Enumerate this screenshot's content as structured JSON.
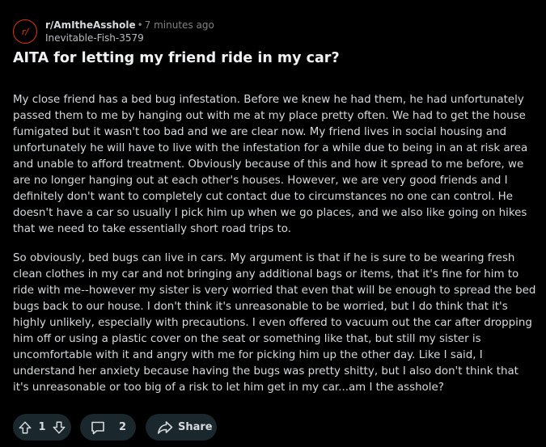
{
  "post": {
    "avatar_text": "r/",
    "subreddit": "r/AmItheAsshole",
    "time": "7 minutes ago",
    "author": "Inevitable-Fish-3579",
    "title": "AITA for letting my friend ride in my car?",
    "body": [
      "My close friend has a bed bug infestation. Before we knew he had them, he had unfortunately passed them to me by hanging out with me at my place pretty often. We had to get the house fumigated but it wasn't too bad and we are clear now. My friend lives in social housing and unfortunately he will have to live with the infestation for a while due to being in an at risk area and unable to afford treatment. Obviously because of this and how it spread to me before, we are no longer hanging out at each other's houses. However, we are very good friends and I definitely don't want to completely cut contact due to circumstances no one can control. He doesn't have a car so usually I pick him up when we go places, and we also like going on hikes that we need to take essentially short road trips to.",
      "So obviously, bed bugs can live in cars. My argument is that if he is sure to be wearing fresh clean clothes in my car and not bringing any additional bags or items, that it's fine for him to ride with me--however my sister is very worried that even that will be enough to spread the bed bugs back to our house. I don't think it's unreasonable to be worried, but I do think that it's highly unlikely, especially with precautions. I even offered to vacuum out the car after dropping him off or using a plastic cover on the seat or something like that, but still my sister is uncomfortable with it and angry with me for picking him up the other day. Like I said, I understand her anxiety because having the bugs was pretty shitty, but I also don't think that it's unreasonable or too big of a risk to let him get in my car...am I the asshole?"
    ]
  },
  "actions": {
    "vote_count": "1",
    "comment_count": "2",
    "share_label": "Share"
  },
  "icons": {
    "upvote": "upvote-icon",
    "downvote": "downvote-icon",
    "comment": "comment-icon",
    "share": "share-icon"
  },
  "colors": {
    "background": "#000000",
    "pill": "#1a282d",
    "text": "#d7dadc",
    "meta": "#818384",
    "accent": "#d93a00"
  }
}
